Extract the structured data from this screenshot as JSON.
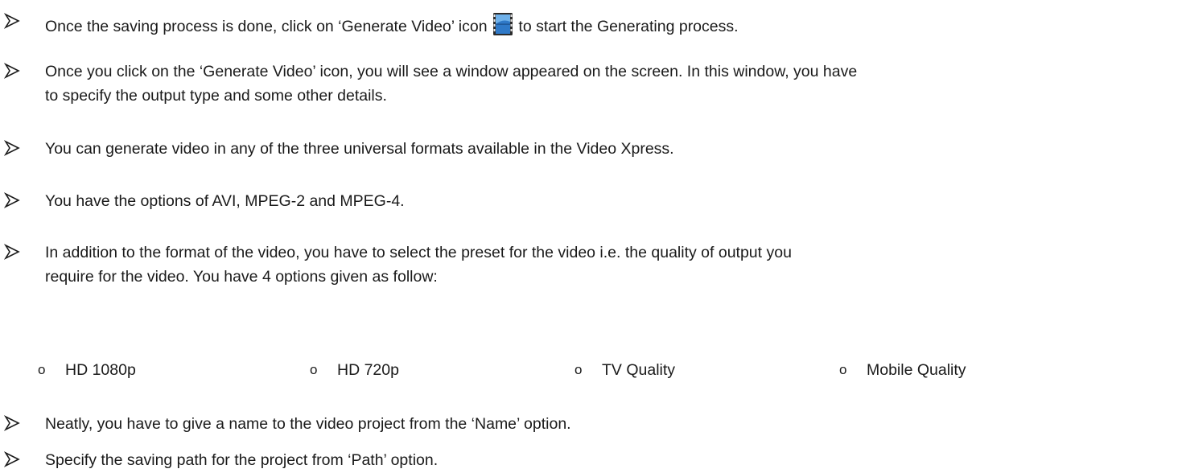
{
  "bullets": [
    {
      "before_icon": "Once the saving process is done, click on ‘Generate Video’ icon ",
      "icon": "film-strip-icon",
      "after_icon": " to start the Generating process."
    },
    {
      "line1": "Once you click on the ‘Generate Video’ icon, you will see a window appeared on the screen. In this window, you have",
      "line2": "to specify the output type and some other details."
    },
    {
      "line1": "You can generate video in any of the three universal formats available in the Video Xpress."
    },
    {
      "line1": "You have the options of AVI, MPEG-2 and MPEG-4."
    },
    {
      "line1": "In addition to the format of the video, you have to select the preset for the video i.e. the quality of output you",
      "line2": "require for the video. You have 4 options given as follow:"
    },
    {
      "line1": "Neatly, you have to give a name to the video project from the ‘Name’ option."
    },
    {
      "line1": "Specify the saving path for the project from ‘Path’ option."
    }
  ],
  "presets": [
    {
      "marker": "o",
      "label": "HD 1080p"
    },
    {
      "marker": "o",
      "label": "HD 720p"
    },
    {
      "marker": "o",
      "label": "TV Quality"
    },
    {
      "marker": "o",
      "label": "Mobile Quality"
    }
  ],
  "icons": {
    "bullet": "arrow-bullet-icon",
    "inline": "film-strip-icon"
  },
  "colors": {
    "text": "#1a1a1a",
    "icon_blue": "#2f79c8",
    "icon_film": "#2b2b2b"
  }
}
